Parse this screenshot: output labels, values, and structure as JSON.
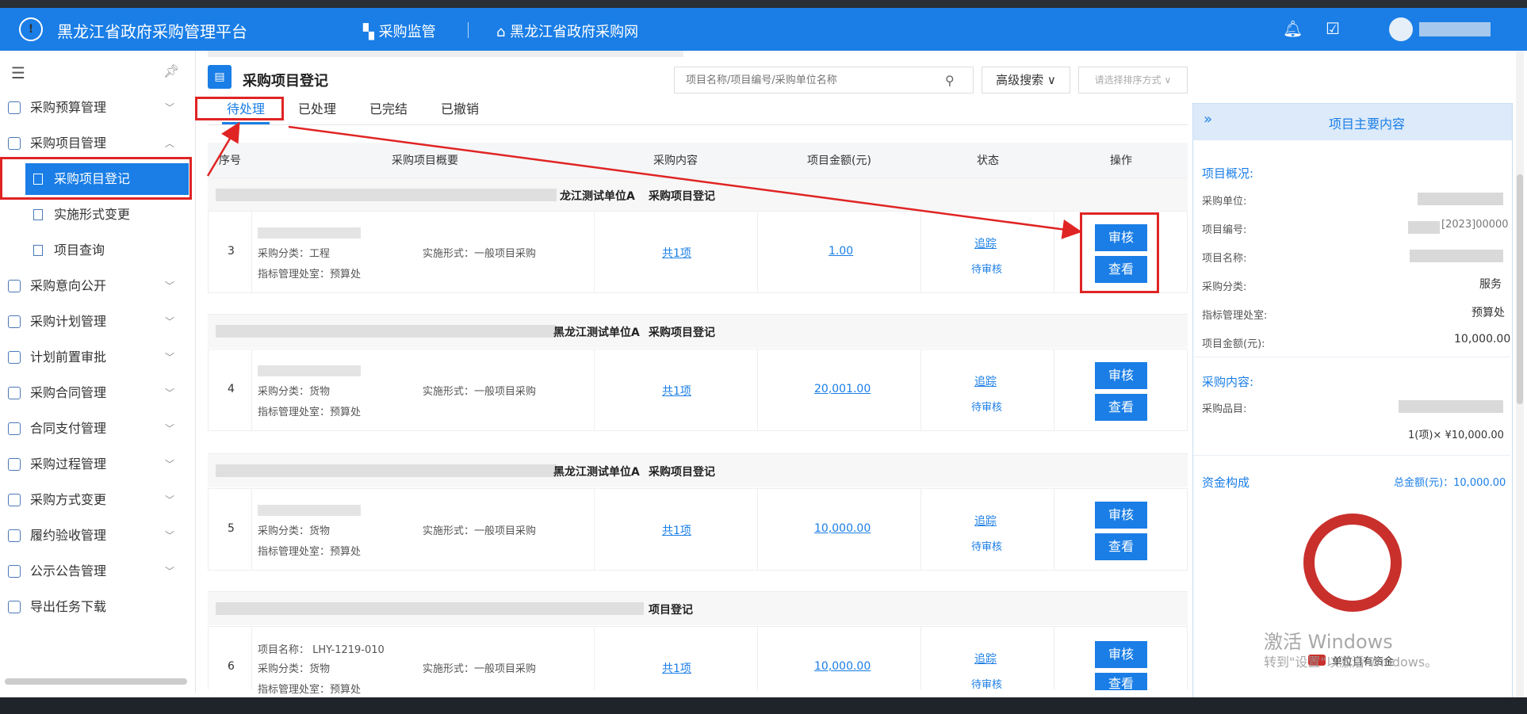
{
  "app": {
    "title": "黑龙江省政府采购管理平台",
    "nav": [
      "采购监管",
      "黑龙江省政府采购网"
    ]
  },
  "sidebar": {
    "items": [
      {
        "label": "采购预算管理",
        "expanded": false
      },
      {
        "label": "采购项目管理",
        "expanded": true
      },
      {
        "label": "采购意向公开",
        "expanded": false
      },
      {
        "label": "采购计划管理",
        "expanded": false
      },
      {
        "label": "计划前置审批",
        "expanded": false
      },
      {
        "label": "采购合同管理",
        "expanded": false
      },
      {
        "label": "合同支付管理",
        "expanded": false
      },
      {
        "label": "采购过程管理",
        "expanded": false
      },
      {
        "label": "采购方式变更",
        "expanded": false
      },
      {
        "label": "履约验收管理",
        "expanded": false
      },
      {
        "label": "公示公告管理",
        "expanded": false
      },
      {
        "label": "导出任务下载",
        "expanded": false
      }
    ],
    "subitems": [
      "采购项目登记",
      "实施形式变更",
      "项目查询"
    ],
    "active_sub": "采购项目登记"
  },
  "page": {
    "title": "采购项目登记"
  },
  "search": {
    "placeholder": "项目名称/项目编号/采购单位名称",
    "advanced": "高级搜索",
    "sort_placeholder": "请选择排序方式"
  },
  "tabs": [
    "待处理",
    "已处理",
    "已完结",
    "已撤销"
  ],
  "table": {
    "headers": [
      "序号",
      "采购项目概要",
      "采购内容",
      "项目金额(元)",
      "状态",
      "操作"
    ],
    "records": [
      {
        "seq": "3",
        "unit": "龙江测试单位A",
        "type": "采购项目登记",
        "name": "",
        "category": "采购分类：工程",
        "form": "实施形式：一般项目采购",
        "dept": "指标管理处室：预算处",
        "content": "共1项",
        "amount": "1.00",
        "track": "追踪",
        "status": "待审核"
      },
      {
        "seq": "4",
        "unit": "黑龙江测试单位A",
        "type": "采购项目登记",
        "name": "",
        "category": "采购分类：货物",
        "form": "实施形式：一般项目采购",
        "dept": "指标管理处室：预算处",
        "content": "共1项",
        "amount": "20,001.00",
        "track": "追踪",
        "status": "待审核"
      },
      {
        "seq": "5",
        "unit": "黑龙江测试单位A",
        "type": "采购项目登记",
        "name": "",
        "category": "采购分类：货物",
        "form": "实施形式：一般项目采购",
        "dept": "指标管理处室：预算处",
        "content": "共1项",
        "amount": "10,000.00",
        "track": "追踪",
        "status": "待审核"
      },
      {
        "seq": "6",
        "unit": "",
        "type": "项目登记",
        "name": "项目名称：  LHY-1219-010",
        "category": "采购分类：货物",
        "form": "实施形式：一般项目采购",
        "dept": "指标管理处室：预算处",
        "content": "共1项",
        "amount": "10,000.00",
        "track": "追踪",
        "status": "待审核"
      }
    ],
    "actions": {
      "review": "审核",
      "view": "查看"
    }
  },
  "panel": {
    "title": "项目主要内容",
    "overview_title": "项目概况:",
    "rows": [
      {
        "label": "采购单位:",
        "value": ""
      },
      {
        "label": "项目编号:",
        "value": "[2023]00000"
      },
      {
        "label": "项目名称:",
        "value": ""
      },
      {
        "label": "采购分类:",
        "value": "服务"
      },
      {
        "label": "指标管理处室:",
        "value": "预算处"
      },
      {
        "label": "项目金额(元):",
        "value": "10,000.00"
      }
    ],
    "content_title": "采购内容:",
    "item_label": "采购品目:",
    "item_total": "1(项)×  ¥10,000.00",
    "fund_title": "资金构成",
    "fund_total": "总金额(元)：10,000.00",
    "legend": "单位自有资金",
    "legend_color": "#c9302c"
  },
  "watermark": {
    "line1": "激活 Windows",
    "line2": "转到\"设置\"以激活 Windows。"
  },
  "colors": {
    "primary": "#1a7ee6",
    "annotation": "#e02424"
  }
}
